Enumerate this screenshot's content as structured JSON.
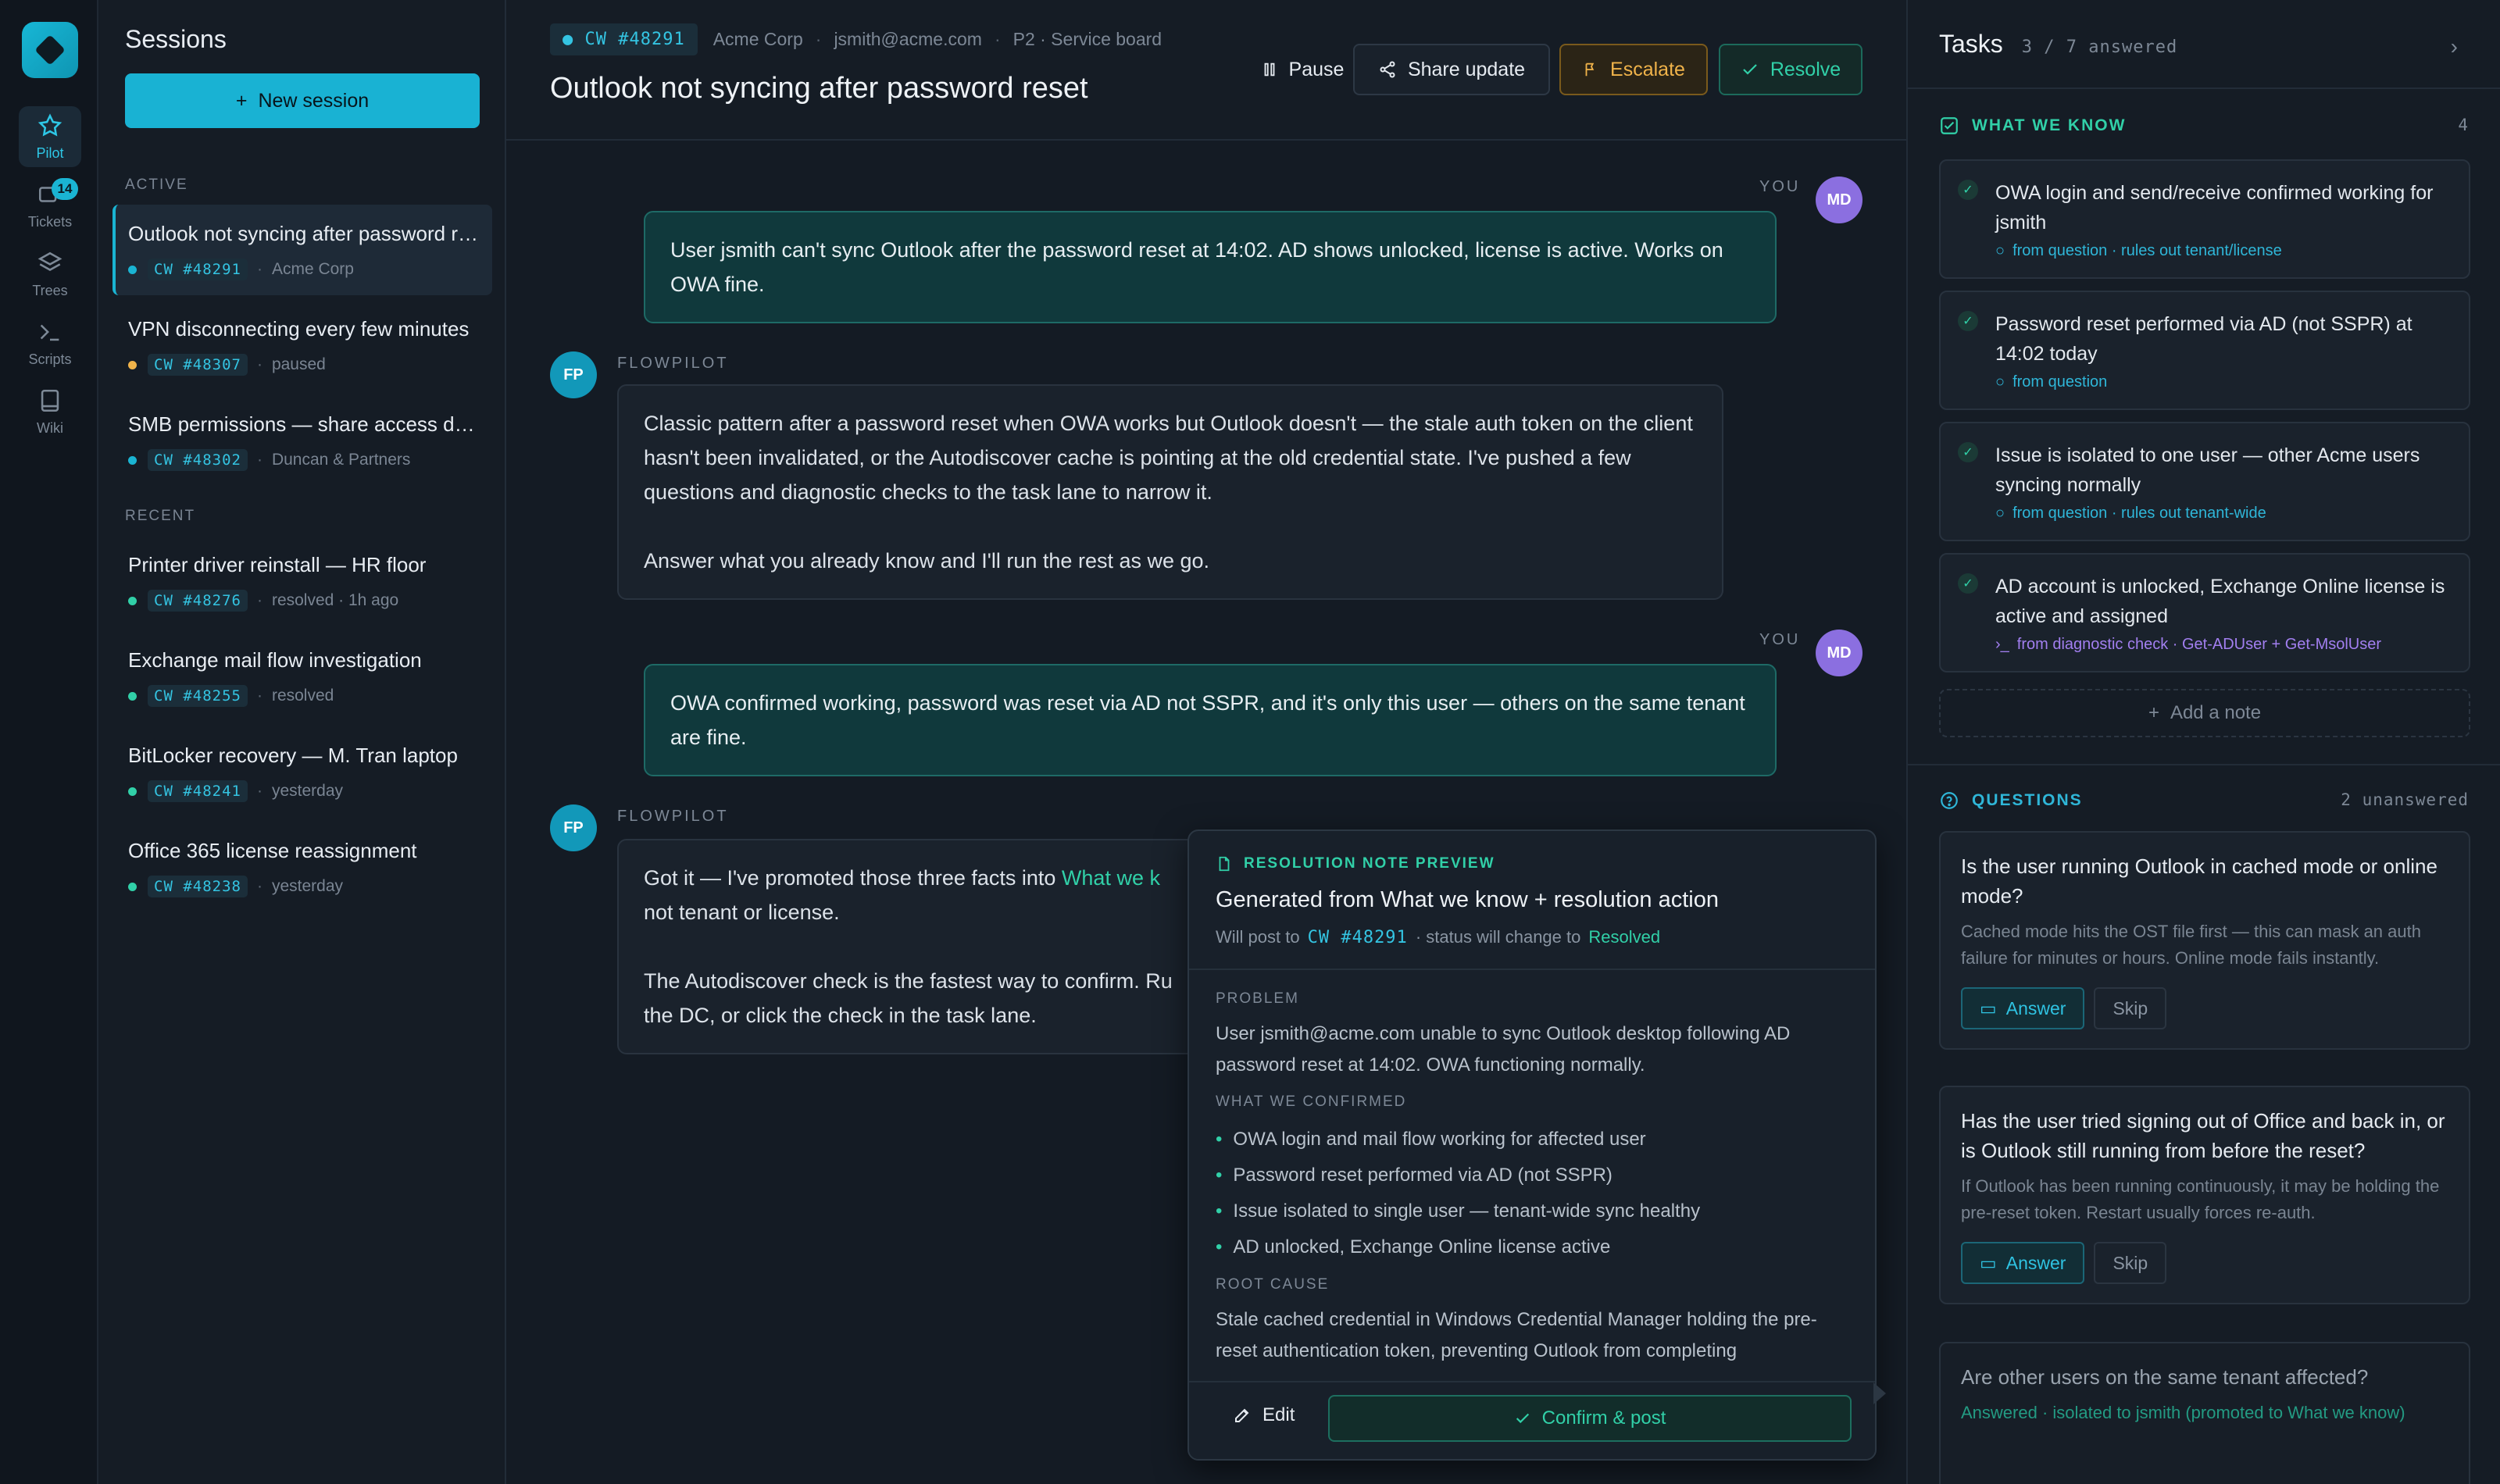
{
  "rail": {
    "items": [
      {
        "label": "Pilot",
        "icon": "star-icon",
        "active": true
      },
      {
        "label": "Tickets",
        "icon": "inbox-icon",
        "badge": "14"
      },
      {
        "label": "Trees",
        "icon": "layers-icon"
      },
      {
        "label": "Scripts",
        "icon": "terminal-icon"
      },
      {
        "label": "Wiki",
        "icon": "book-icon"
      }
    ]
  },
  "sessions": {
    "title": "Sessions",
    "new_label": "New session",
    "active_label": "ACTIVE",
    "recent_label": "RECENT",
    "active": [
      {
        "title": "Outlook not syncing after password reset",
        "ticket": "CW #48291",
        "meta": "Acme Corp",
        "dot": "#1ab4d3"
      },
      {
        "title": "VPN disconnecting every few minutes",
        "ticket": "CW #48307",
        "meta": "paused",
        "dot": "#f0b34a"
      },
      {
        "title": "SMB permissions — share access denied",
        "ticket": "CW #48302",
        "meta": "Duncan & Partners",
        "dot": "#1ab4d3"
      }
    ],
    "recent": [
      {
        "title": "Printer driver reinstall — HR floor",
        "ticket": "CW #48276",
        "meta": "resolved · 1h ago",
        "dot": "#31d0a8"
      },
      {
        "title": "Exchange mail flow investigation",
        "ticket": "CW #48255",
        "meta": "resolved",
        "dot": "#31d0a8"
      },
      {
        "title": "BitLocker recovery — M. Tran laptop",
        "ticket": "CW #48241",
        "meta": "yesterday",
        "dot": "#31d0a8"
      },
      {
        "title": "Office 365 license reassignment",
        "ticket": "CW #48238",
        "meta": "yesterday",
        "dot": "#31d0a8"
      }
    ]
  },
  "header": {
    "ticket": "CW #48291",
    "company": "Acme Corp",
    "email": "jsmith@acme.com",
    "board": "P2 · Service board",
    "title": "Outlook not syncing after password reset",
    "pause": "Pause",
    "share": "Share update",
    "escalate": "Escalate",
    "resolve": "Resolve"
  },
  "chat": {
    "you_label": "YOU",
    "fp_label": "FLOWPILOT",
    "you_initials": "MD",
    "fp_initials": "FP",
    "m1": "User jsmith can't sync Outlook after the password reset at 14:02. AD shows unlocked, license is active. Works on OWA fine.",
    "m2a": "Classic pattern after a password reset when OWA works but Outlook doesn't — the stale auth token on the client hasn't been invalidated, or the Autodiscover cache is pointing at the old credential state. I've pushed a few questions and diagnostic checks to the task lane to narrow it.",
    "m2b": "Answer what you already know and I'll run the rest as we go.",
    "m3": "OWA confirmed working, password was reset via AD not SSPR, and it's only this user — others on the same tenant are fine.",
    "m4a_pre": "Got it — I've promoted those three facts into ",
    "m4a_hl": "What we k",
    "m4a_post": "not tenant or license.",
    "m4b": "The Autodiscover check is the fastest way to confirm. Ru",
    "m4c": "the DC, or click the check in the task lane."
  },
  "preview": {
    "label": "RESOLUTION NOTE PREVIEW",
    "title": "Generated from What we know + resolution action",
    "will_post": "Will post to",
    "ticket": "CW #48291",
    "status_change": "· status will change to",
    "status": "Resolved",
    "problem_h": "PROBLEM",
    "problem": "User jsmith@acme.com unable to sync Outlook desktop following AD password reset at 14:02. OWA functioning normally.",
    "confirmed_h": "WHAT WE CONFIRMED",
    "confirmed": [
      "OWA login and mail flow working for affected user",
      "Password reset performed via AD (not SSPR)",
      "Issue isolated to single user — tenant-wide sync healthy",
      "AD unlocked, Exchange Online license active"
    ],
    "root_h": "ROOT CAUSE",
    "root": "Stale cached credential in Windows Credential Manager holding the pre-reset authentication token, preventing Outlook from completing",
    "edit": "Edit",
    "confirm": "Confirm & post"
  },
  "tasks": {
    "title": "Tasks",
    "count": "3 / 7 answered",
    "know_h": "WHAT WE KNOW",
    "know_count": "4",
    "know": [
      {
        "text": "OWA login and send/receive confirmed working for jsmith",
        "src": "from question · rules out tenant/license",
        "kind": "question"
      },
      {
        "text": "Password reset performed via AD (not SSPR) at 14:02 today",
        "src": "from question",
        "kind": "question"
      },
      {
        "text": "Issue is isolated to one user — other Acme users syncing normally",
        "src": "from question · rules out tenant-wide",
        "kind": "question"
      },
      {
        "text": "AD account is unlocked, Exchange Online license is active and assigned",
        "src": "from diagnostic check · Get-ADUser + Get-MsolUser",
        "kind": "diag"
      }
    ],
    "add_note": "Add a note",
    "q_h": "QUESTIONS",
    "q_count": "2 unanswered",
    "questions": [
      {
        "q": "Is the user running Outlook in cached mode or online mode?",
        "hint": "Cached mode hits the OST file first — this can mask an auth failure for minutes or hours. Online mode fails instantly."
      },
      {
        "q": "Has the user tried signing out of Office and back in, or is Outlook still running from before the reset?",
        "hint": "If Outlook has been running continuously, it may be holding the pre-reset token. Restart usually forces re-auth."
      }
    ],
    "answer": "Answer",
    "skip": "Skip",
    "answered_q": "Are other users on the same tenant affected?",
    "answered_a": "Answered · isolated to jsmith (promoted to What we know)"
  }
}
